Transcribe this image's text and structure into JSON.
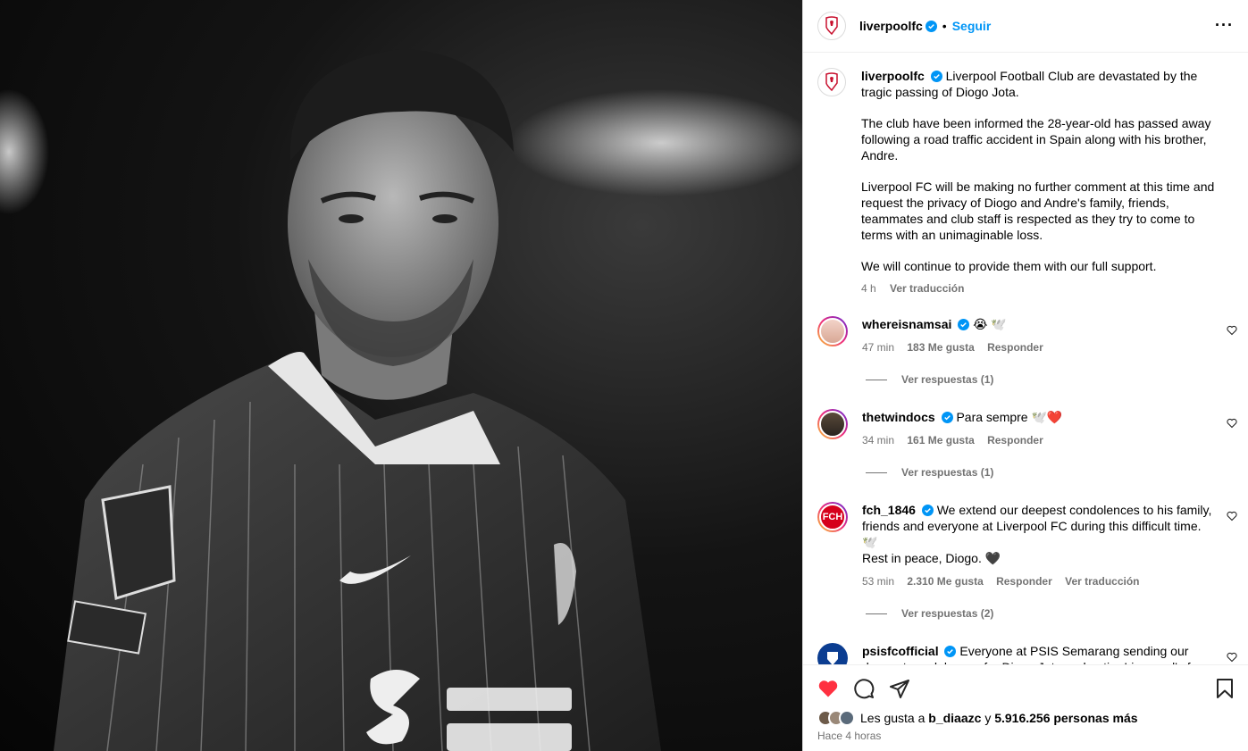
{
  "header": {
    "username": "liverpoolfc",
    "separator": "•",
    "follow_label": "Seguir",
    "more_label": "···"
  },
  "caption": {
    "username": "liverpoolfc",
    "paragraphs": [
      "Liverpool Football Club are devastated by the tragic passing of Diogo Jota.",
      "The club have been informed the 28-year-old has passed away following a road traffic accident in Spain along with his brother, Andre.",
      "Liverpool FC will be making no further comment at this time and request the privacy of Diogo and Andre's family, friends, teammates and club staff is respected as they try to come to terms with an unimaginable loss.",
      "We will continue to provide them with our full support."
    ],
    "time": "4 h",
    "translate": "Ver traducción"
  },
  "comments": [
    {
      "username": "whereisnamsai",
      "text": "😭 🕊️",
      "time": "47 min",
      "likes": "183 Me gusta",
      "reply": "Responder",
      "view_replies": "Ver respuestas (1)"
    },
    {
      "username": "thetwindocs",
      "text": "Para sempre 🕊️❤️",
      "time": "34 min",
      "likes": "161 Me gusta",
      "reply": "Responder",
      "view_replies": "Ver respuestas (1)"
    },
    {
      "username": "fch_1846",
      "text": "We extend our deepest condolences to his family, friends and everyone at Liverpool FC during this difficult time. 🕊️",
      "text2": "Rest in peace, Diogo. 🖤",
      "time": "53 min",
      "likes": "2.310 Me gusta",
      "reply": "Responder",
      "translate": "Ver traducción",
      "view_replies": "Ver respuestas (2)"
    },
    {
      "username": "psisfcofficial",
      "text": "Everyone at PSIS Semarang sending our deepest condolences for Diogo Jota and entire Liverpool's fans."
    }
  ],
  "likes": {
    "prefix": "Les gusta a",
    "user": "b_diaazc",
    "middle": "y",
    "count": "5.916.256 personas más"
  },
  "posted": "Hace 4 horas",
  "badge": {
    "fch": "FCH"
  },
  "colors": {
    "accent": "#0095f6",
    "like": "#ff3040",
    "lfc_red": "#c8102e"
  }
}
